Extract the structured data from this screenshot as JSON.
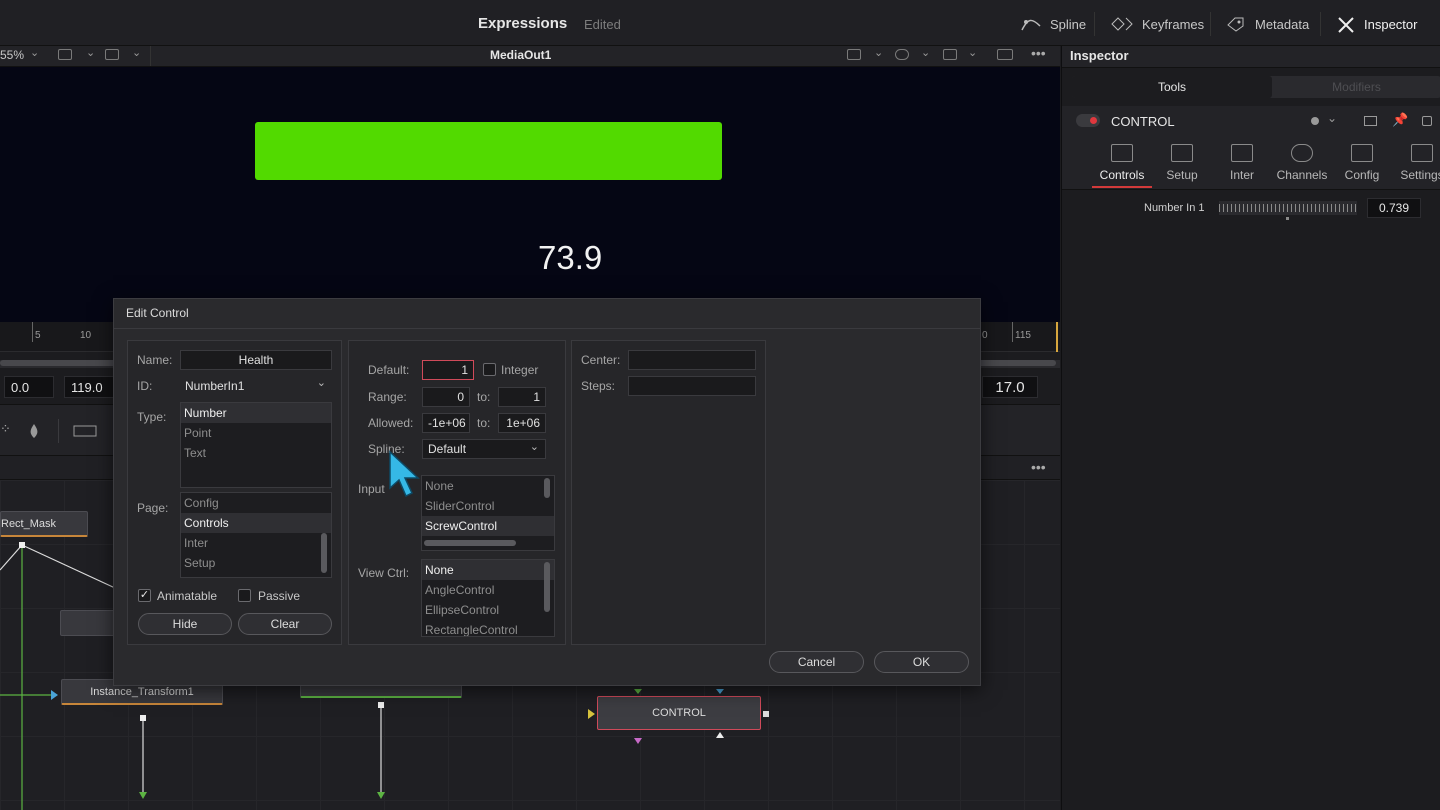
{
  "topbar": {
    "title": "Expressions",
    "status": "Edited",
    "buttons": [
      {
        "label": "Spline",
        "icon": "spline-icon"
      },
      {
        "label": "Keyframes",
        "icon": "keyframes-icon"
      },
      {
        "label": "Metadata",
        "icon": "metadata-icon"
      },
      {
        "label": "Inspector",
        "icon": "inspector-icon"
      }
    ]
  },
  "viewer": {
    "zoom": "55%",
    "node_name": "MediaOut1",
    "bar_color": "#52da00",
    "display_value": "73.9"
  },
  "timeline": {
    "ticks_left": [
      "5",
      "10"
    ],
    "ticks_right": [
      "0",
      "115"
    ],
    "start": "0.0",
    "end": "119.0",
    "current": "17.0"
  },
  "nodes": {
    "items": [
      "Rect_Mask",
      "Instance_Transform1",
      "CONTROL"
    ]
  },
  "inspector": {
    "title": "Inspector",
    "tabs": [
      "Tools",
      "Modifiers"
    ],
    "tool_name": "CONTROL",
    "subtabs": [
      "Controls",
      "Setup",
      "Inter",
      "Channels",
      "Config",
      "Settings"
    ],
    "param_label": "Number In 1",
    "param_value": "0.739",
    "param_fraction": 0.739
  },
  "dialog": {
    "title": "Edit Control",
    "name_label": "Name:",
    "name_value": "Health",
    "id_label": "ID:",
    "id_value": "NumberIn1",
    "type_label": "Type:",
    "types": [
      "Number",
      "Point",
      "Text"
    ],
    "page_label": "Page:",
    "pages": [
      "Config",
      "Controls",
      "Inter",
      "Setup"
    ],
    "animatable_label": "Animatable",
    "passive_label": "Passive",
    "hide_label": "Hide",
    "clear_label": "Clear",
    "default_label": "Default:",
    "default_value": "1",
    "integer_label": "Integer",
    "range_label": "Range:",
    "range_min": "0",
    "range_to": "to:",
    "range_max": "1",
    "allowed_label": "Allowed:",
    "allowed_min": "-1e+06",
    "allowed_to": "to:",
    "allowed_max": "1e+06",
    "spline_label": "Spline:",
    "spline_value": "Default",
    "input_label": "Input",
    "inputs": [
      "None",
      "SliderControl",
      "ScrewControl"
    ],
    "viewctrl_label": "View Ctrl:",
    "viewctrls": [
      "None",
      "AngleControl",
      "EllipseControl",
      "RectangleControl"
    ],
    "center_label": "Center:",
    "steps_label": "Steps:",
    "cancel_label": "Cancel",
    "ok_label": "OK"
  }
}
